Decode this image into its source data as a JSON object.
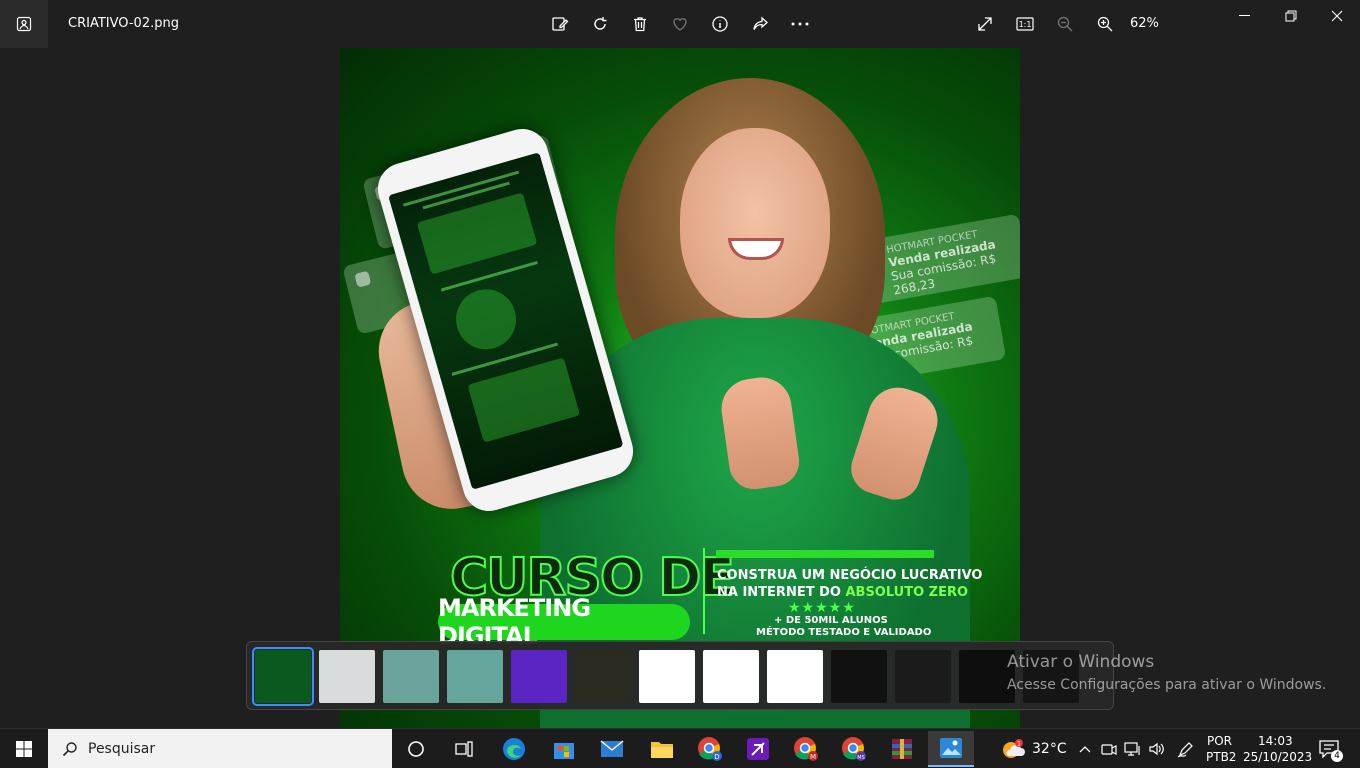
{
  "window": {
    "filename": "CRIATIVO-02.png",
    "zoom": "62%"
  },
  "icons": {
    "app": "photos-icon",
    "edit": "edit-image-icon",
    "rotate": "rotate-icon",
    "delete": "trash-icon",
    "favorite": "heart-icon",
    "info": "info-icon",
    "share": "share-icon",
    "more": "more-icon",
    "fullscreen": "fullscreen-icon",
    "actual_size": "actual-size-icon",
    "zoom_out": "zoom-out-icon",
    "zoom_in": "zoom-in-icon",
    "minimize": "minimize-icon",
    "maximize": "maximize-icon",
    "close": "close-icon"
  },
  "creative": {
    "notifications": [
      {
        "app": "HOTMART POCKET",
        "title": "Venda realizada",
        "body": "Sua comissão: R$ 268,23"
      },
      {
        "app": "HOTMART POCKET",
        "title": "Venda realizada",
        "body": "Sua comissão: R$ 68,80"
      }
    ],
    "headline_1": "CURSO DE",
    "headline_2": "MARKETING DIGITAL",
    "tagline_1": "CONSTRUA UM NEGÓCIO LUCRATIVO",
    "tagline_2_prefix": "NA INTERNET DO ",
    "tagline_2_highlight": "ABSOLUTO ZERO",
    "stars": "★★★★★",
    "students": "+ DE 50MIL ALUNOS",
    "method": "MÉTODO TESTADO E VALIDADO",
    "accent_color": "#2bdc2b"
  },
  "filmstrip": {
    "thumbnails": [
      {
        "name": "criativo-02",
        "color": "#0a5a20",
        "selected": true
      },
      {
        "name": "zucu-senna-1",
        "color": "#d8dcdc",
        "selected": false
      },
      {
        "name": "zucu-senna-2",
        "color": "#6aa49a",
        "selected": false
      },
      {
        "name": "zucu-senna-3",
        "color": "#64a69c",
        "selected": false
      },
      {
        "name": "atencao-filiados",
        "color": "#5b25c4",
        "selected": false
      },
      {
        "name": "dark-poster",
        "color": "#2b2b20",
        "selected": false
      },
      {
        "name": "hearts-1",
        "color": "#ffffff",
        "selected": false
      },
      {
        "name": "hearts-2",
        "color": "#ffffff",
        "selected": false
      },
      {
        "name": "hearts-3",
        "color": "#ffffff",
        "selected": false
      },
      {
        "name": "quote-amor",
        "color": "#111111",
        "selected": false
      },
      {
        "name": "quote-dark",
        "color": "#1b1b1b",
        "selected": false
      },
      {
        "name": "quote-bonito",
        "color": "#0e0e0e",
        "selected": false
      },
      {
        "name": "quote-vc",
        "color": "#151515",
        "selected": false
      }
    ]
  },
  "watermark": {
    "line1": "Ativar o Windows",
    "line2": "Acesse Configurações para ativar o Windows."
  },
  "taskbar": {
    "search_placeholder": "Pesquisar",
    "apps": [
      {
        "name": "cortana-icon"
      },
      {
        "name": "task-view-icon"
      },
      {
        "name": "edge-icon"
      },
      {
        "name": "store-icon"
      },
      {
        "name": "mail-icon"
      },
      {
        "name": "file-explorer-icon"
      },
      {
        "name": "chrome-d-icon"
      },
      {
        "name": "purple-app-icon"
      },
      {
        "name": "chrome-m-icon"
      },
      {
        "name": "chrome-ms-icon"
      },
      {
        "name": "winrar-icon"
      },
      {
        "name": "photos-icon"
      }
    ],
    "temperature": "32°C",
    "lang_1": "POR",
    "lang_2": "PTB2",
    "time": "14:03",
    "date": "25/10/2023",
    "notification_count": "4"
  }
}
